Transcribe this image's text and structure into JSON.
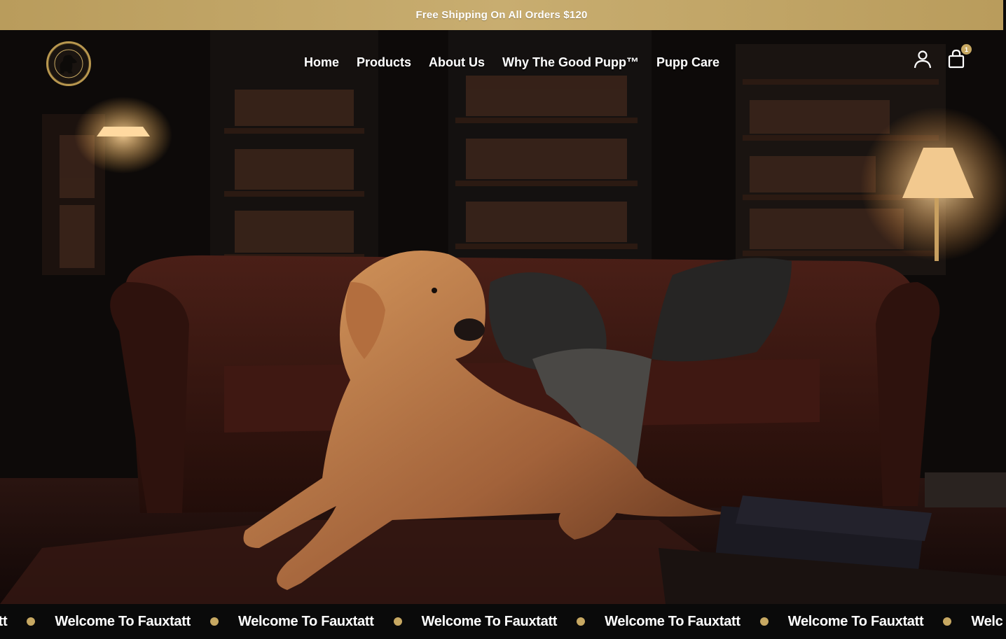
{
  "announcement": {
    "text": "Free Shipping On All Orders $120"
  },
  "header": {
    "logo_alt": "dog-silhouette-logo",
    "nav": [
      {
        "label": "Home"
      },
      {
        "label": "Products"
      },
      {
        "label": "About Us"
      },
      {
        "label": "Why The Good Pupp™"
      },
      {
        "label": "Pupp Care"
      }
    ],
    "account_icon": "user-icon",
    "cart_icon": "shopping-bag-icon",
    "cart_count": "1"
  },
  "hero": {
    "image": "golden-retriever-in-library"
  },
  "marquee": {
    "items": [
      "Fauxtatt",
      "Welcome To Fauxtatt",
      "Welcome To Fauxtatt",
      "Welcome To Fauxtatt",
      "Welcome To Fauxtatt",
      "Welcome To Fauxtatt",
      "Welc"
    ]
  },
  "colors": {
    "gold": "#c7a862",
    "dark": "#0b0a0a",
    "white": "#ffffff"
  }
}
